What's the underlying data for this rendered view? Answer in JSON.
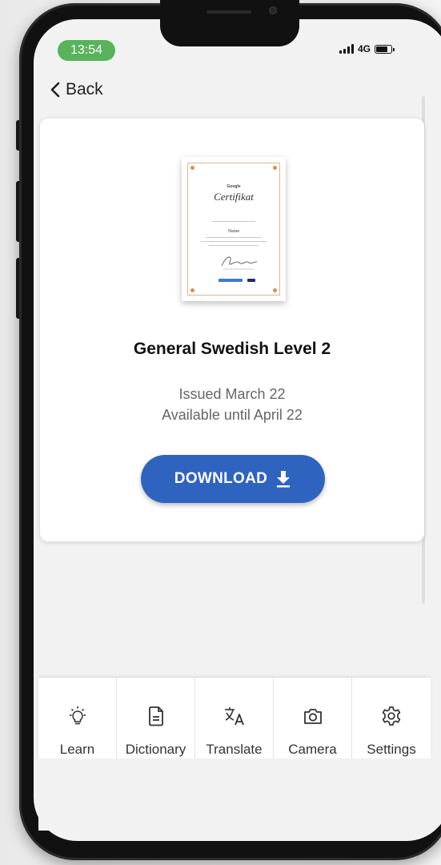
{
  "status_bar": {
    "time": "13:54",
    "network": "4G",
    "time_pill_color": "#58b35a"
  },
  "nav": {
    "back_label": "Back"
  },
  "certificate": {
    "brand": "Google",
    "title": "Certifikat",
    "recipient": "Name"
  },
  "course": {
    "title": "General Swedish Level 2",
    "issued": "Issued March 22",
    "available": "Available until April 22"
  },
  "download": {
    "label": "DOWNLOAD",
    "icon": "download-icon",
    "color": "#2f63c0"
  },
  "tabs": [
    {
      "label": "Learn",
      "icon": "lightbulb-icon"
    },
    {
      "label": "Dictionary",
      "icon": "document-icon"
    },
    {
      "label": "Translate",
      "icon": "translate-icon"
    },
    {
      "label": "Camera",
      "icon": "camera-icon"
    },
    {
      "label": "Settings",
      "icon": "settings-icon"
    }
  ]
}
